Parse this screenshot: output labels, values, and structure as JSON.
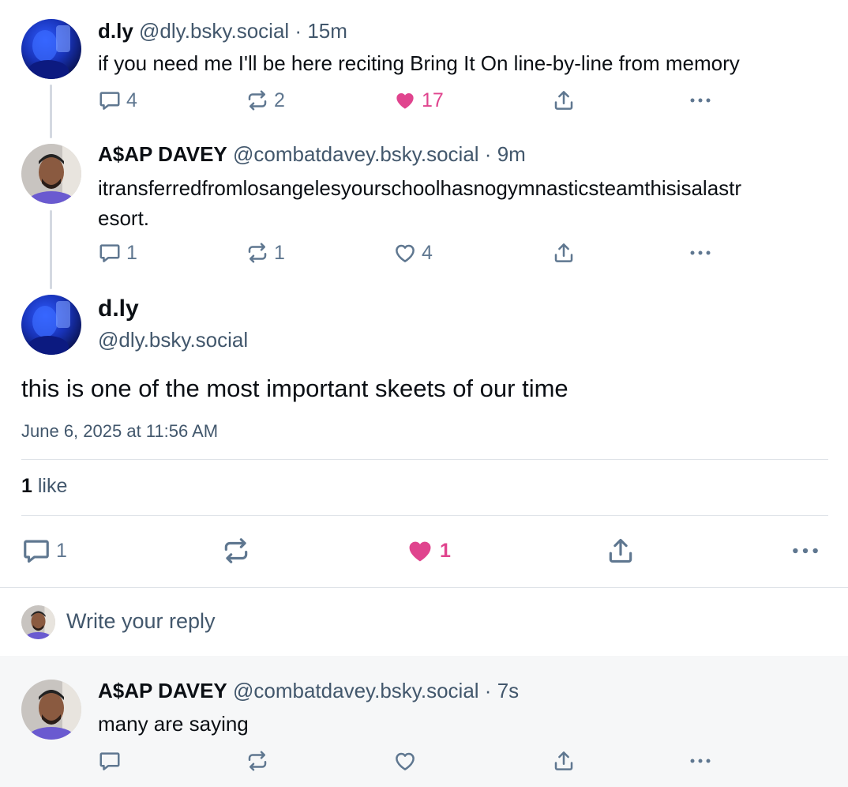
{
  "posts": [
    {
      "name": "d.ly",
      "handle": "@dly.bsky.social",
      "sep": "·",
      "time": "15m",
      "text": "if you need me I'll be here reciting Bring It On line-by-line from memory",
      "replies": "4",
      "reposts": "2",
      "likes": "17",
      "liked": true
    },
    {
      "name": "A$AP DAVEY",
      "handle": "@combatdavey.bsky.social",
      "sep": "·",
      "time": "9m",
      "text_line1": "itransferredfromlosangelesyourschoolhasnogymnasticsteamthisisalastr",
      "text_line2": "esort.",
      "replies": "1",
      "reposts": "1",
      "likes": "4",
      "liked": false
    }
  ],
  "focused": {
    "name": "d.ly",
    "handle": "@dly.bsky.social",
    "text": "this is one of the most important skeets of our time",
    "date": "June 6, 2025 at 11:56 AM",
    "like_count": "1",
    "like_word": "like",
    "replies": "1",
    "reposts": "",
    "likes": "1",
    "liked": true
  },
  "composer": {
    "placeholder": "Write your reply"
  },
  "reply": {
    "name": "A$AP DAVEY",
    "handle": "@combatdavey.bsky.social",
    "sep": "·",
    "time": "7s",
    "text": "many are saying"
  },
  "icons": {
    "reply": "reply-bubble-icon",
    "repost": "repost-icon",
    "like": "heart-icon",
    "share": "share-icon",
    "more": "more-dots-icon"
  },
  "colors": {
    "like_pink": "#e0448e",
    "muted": "#5f7790",
    "handle": "#42576c",
    "thread_line": "#d4d9e1",
    "reply_bg": "#f6f7f8"
  }
}
